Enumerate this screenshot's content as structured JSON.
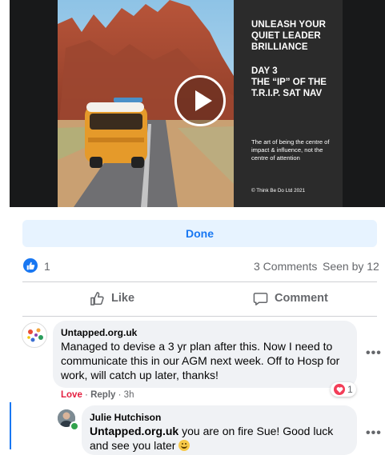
{
  "video": {
    "slide_title": "UNLEASH YOUR QUIET LEADER BRILLIANCE",
    "slide_day": "DAY 3",
    "slide_subtitle": "THE “IP” OF THE T.R.I.P. SAT NAV",
    "slide_description": "The art of being the centre of impact & influence, not the centre of attention",
    "slide_copyright": "© Think Be Do Ltd 2021",
    "play_icon": "play-icon"
  },
  "done_button": {
    "label": "Done"
  },
  "reactions": {
    "like_count": "1",
    "comments_count": "3 Comments",
    "seen_by": "Seen by 12",
    "like_icon": "thumbs-up-icon",
    "like_color": "#1877f2"
  },
  "actions": {
    "like_label": "Like",
    "comment_label": "Comment"
  },
  "comments": [
    {
      "author": "Untapped.org.uk",
      "text": "Managed to devise a 3 yr plan after this. Now I need to communicate this in our AGM next week. Off to Hosp for work, will catch up later, thanks!",
      "love_label": "Love",
      "reply_label": "Reply",
      "separator": "·",
      "time": "3h",
      "reaction_count": "1",
      "reaction_icon": "heart-icon",
      "more_label": "•••"
    },
    {
      "author": "Julie Hutchison",
      "mention": "Untapped.org.uk",
      "text": " you are on fire Sue! Good luck and see you later ",
      "emoji_icon": "smiling-face-emoji",
      "more_label": "•••"
    }
  ],
  "colors": {
    "accent": "#1877f2",
    "love": "#e41e3f",
    "bubble": "#f0f2f5"
  }
}
